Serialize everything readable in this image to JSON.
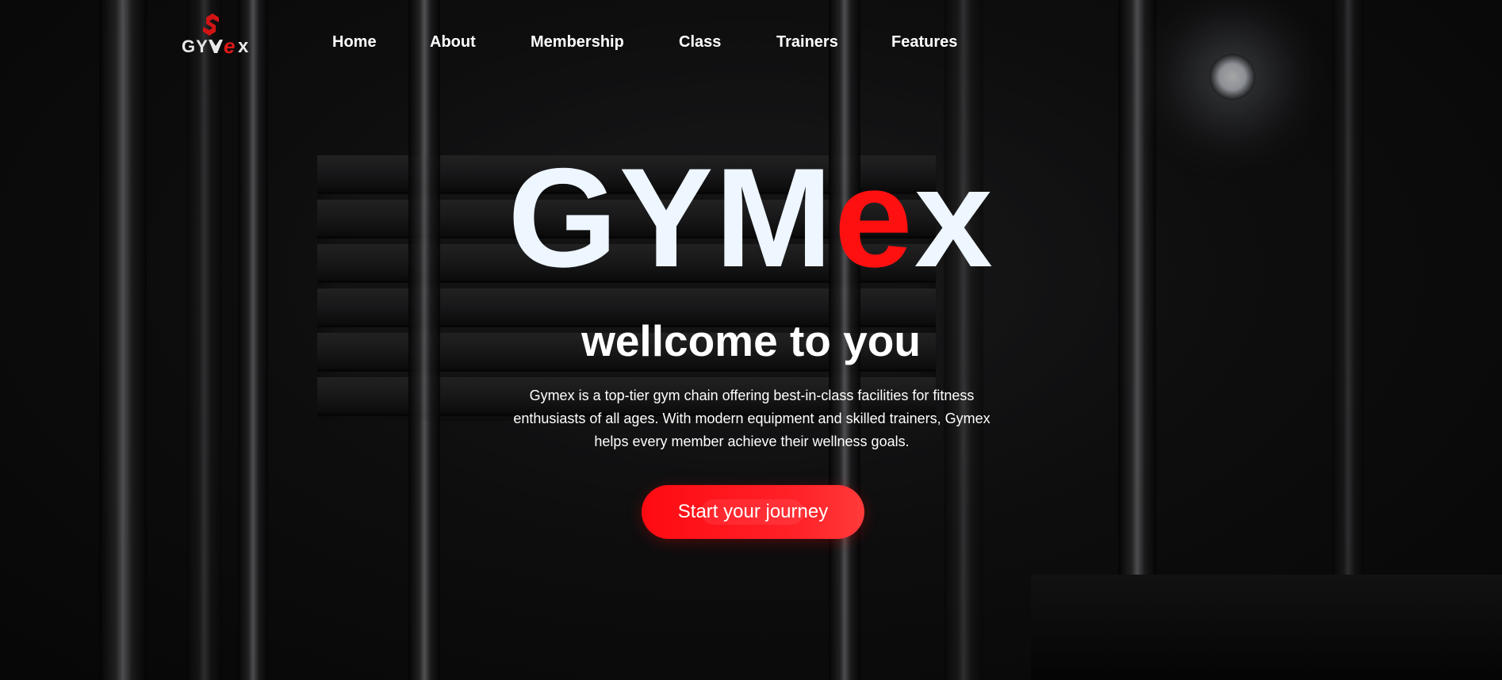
{
  "brand": {
    "logo_text": "GYMex",
    "logo_icon": "gymex-logo-mark"
  },
  "nav": {
    "items": [
      {
        "label": "Home"
      },
      {
        "label": "About"
      },
      {
        "label": "Membership"
      },
      {
        "label": "Class"
      },
      {
        "label": "Trainers"
      },
      {
        "label": "Features"
      }
    ]
  },
  "hero": {
    "title_main": "GYM",
    "title_accent": "e",
    "title_end": "x",
    "subtitle": "wellcome to you",
    "description": "Gymex is a top-tier gym chain offering best-in-class facilities for fitness enthusiasts of all ages. With modern equipment and skilled trainers, Gymex helps every member achieve their wellness goals.",
    "cta_label": "Start your journey"
  },
  "colors": {
    "accent": "#ff1010",
    "title_white": "#eef6ff",
    "text": "#ffffff",
    "button": "#ff1a1a"
  }
}
